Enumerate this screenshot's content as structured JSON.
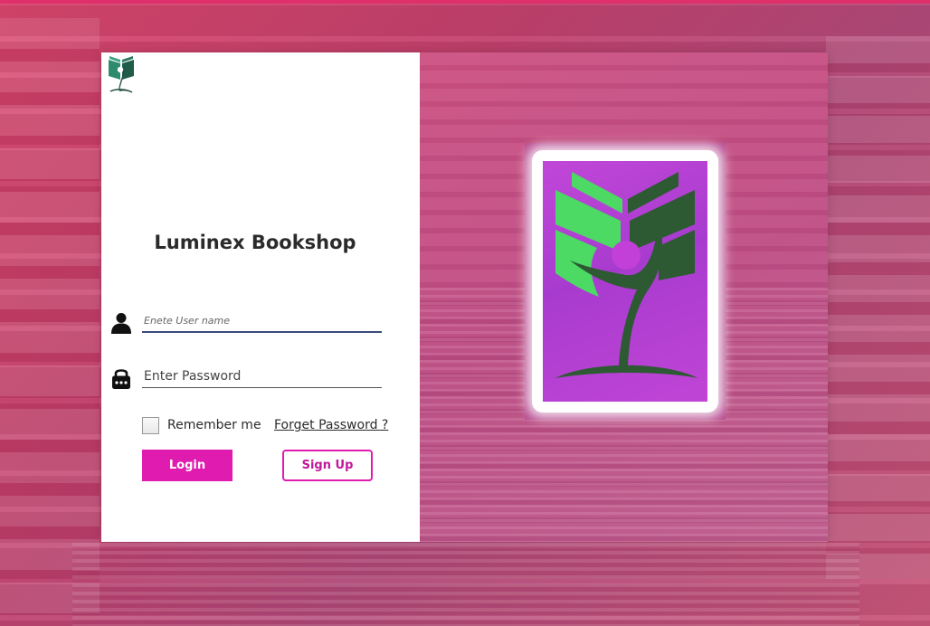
{
  "app": {
    "title": "Luminex Bookshop",
    "logo_icon": "book-person-logo-icon"
  },
  "form": {
    "username_placeholder": "Enete User name",
    "password_placeholder": "Enter Password",
    "username_icon": "user-icon",
    "password_icon": "lock-icon",
    "remember_label": "Remember me",
    "remember_checked": false,
    "forget_label": "Forget Password ?",
    "login_label": "Login",
    "signup_label": "Sign Up"
  },
  "colors": {
    "accent": "#e01cb0",
    "background": "#c2416e",
    "logo_green": "#4cd964",
    "logo_dark_green": "#2d5a32",
    "logo_purple": "#b040d4"
  }
}
